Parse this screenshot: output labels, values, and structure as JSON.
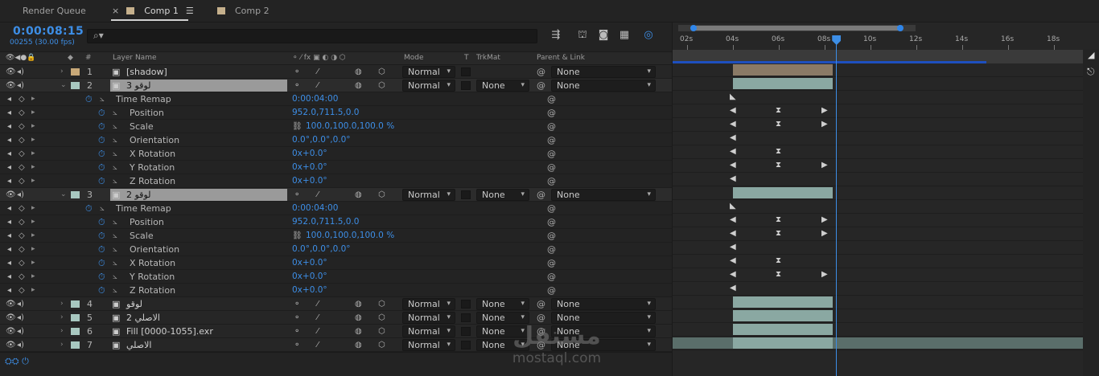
{
  "tabs": [
    {
      "label": "Render Queue"
    },
    {
      "label": "Comp 1",
      "close": "×",
      "menu": "☰"
    },
    {
      "label": "Comp 2"
    }
  ],
  "colors": {
    "accent": "#3d8ee6",
    "comp1": "#c5b08c",
    "comp2": "#c5b08c",
    "label_tan": "#c8a878",
    "label_aqua": "#a8c8c0",
    "bar_shadow": "#8a7a66",
    "bar_aqua": "#8aa8a2"
  },
  "header": {
    "timecode": "0:00:08:15",
    "frames": "00255 (30.00 fps)",
    "search_placeholder": ""
  },
  "columns": {
    "layer_name": "Layer Name",
    "hash": "#",
    "mode": "Mode",
    "t": "T",
    "trkmat": "TrkMat",
    "parent": "Parent & Link",
    "switch_glyphs": "⚬ ⁄ fx ▣ ◐ ◑ ⬡"
  },
  "rows": [
    {
      "type": "layer",
      "num": "1",
      "name": "[shadow]",
      "mode": "Normal",
      "trkmat": "",
      "parent": "None",
      "label": "tan"
    },
    {
      "type": "layer",
      "num": "2",
      "name": "لوقو 3",
      "mode": "Normal",
      "trkmat": "None",
      "parent": "None",
      "label": "aqua",
      "selected": true
    },
    {
      "type": "prop",
      "name": "Time Remap",
      "value": "0:00:04:00"
    },
    {
      "type": "prop",
      "name": "Position",
      "value": "952.0,711.5,0.0"
    },
    {
      "type": "prop",
      "name": "Scale",
      "value": "100.0,100.0,100.0 %"
    },
    {
      "type": "prop",
      "name": "Orientation",
      "value": "0.0°,0.0°,0.0°"
    },
    {
      "type": "prop",
      "name": "X Rotation",
      "value": "0x+0.0°"
    },
    {
      "type": "prop",
      "name": "Y Rotation",
      "value": "0x+0.0°"
    },
    {
      "type": "prop",
      "name": "Z Rotation",
      "value": "0x+0.0°"
    },
    {
      "type": "layer",
      "num": "3",
      "name": "لوقو 2",
      "mode": "Normal",
      "trkmat": "None",
      "parent": "None",
      "label": "aqua",
      "selected": true
    },
    {
      "type": "prop",
      "name": "Time Remap",
      "value": "0:00:04:00"
    },
    {
      "type": "prop",
      "name": "Position",
      "value": "952.0,711.5,0.0"
    },
    {
      "type": "prop",
      "name": "Scale",
      "value": "100.0,100.0,100.0 %"
    },
    {
      "type": "prop",
      "name": "Orientation",
      "value": "0.0°,0.0°,0.0°"
    },
    {
      "type": "prop",
      "name": "X Rotation",
      "value": "0x+0.0°"
    },
    {
      "type": "prop",
      "name": "Y Rotation",
      "value": "0x+0.0°"
    },
    {
      "type": "prop",
      "name": "Z Rotation",
      "value": "0x+0.0°"
    },
    {
      "type": "layer",
      "num": "4",
      "name": "لوقو",
      "mode": "Normal",
      "trkmat": "None",
      "parent": "None",
      "label": "aqua"
    },
    {
      "type": "layer",
      "num": "5",
      "name": "الاصلي 2",
      "mode": "Normal",
      "trkmat": "None",
      "parent": "None",
      "label": "aqua"
    },
    {
      "type": "layer",
      "num": "6",
      "name": "Fill [0000-1055].exr",
      "mode": "Normal",
      "trkmat": "None",
      "parent": "None",
      "label": "aqua"
    },
    {
      "type": "layer",
      "num": "7",
      "name": "الاصلي",
      "mode": "Normal",
      "trkmat": "None",
      "parent": "None",
      "label": "aqua"
    }
  ],
  "ruler": {
    "ticks": [
      "02s",
      "04s",
      "06s",
      "08s",
      "10s",
      "12s",
      "14s",
      "16s",
      "18s"
    ]
  },
  "playhead_seconds": 8.5,
  "watermark": {
    "arabic": "مستقل",
    "latin": "mostaql.com"
  },
  "icons": {
    "search": "search-icon",
    "eye": "eye-icon",
    "audio": "audio-icon",
    "solo": "solo-icon",
    "lock": "lock-icon",
    "stopwatch": "stopwatch-icon",
    "graph": "graph-icon",
    "pickwhip": "pickwhip-icon"
  }
}
